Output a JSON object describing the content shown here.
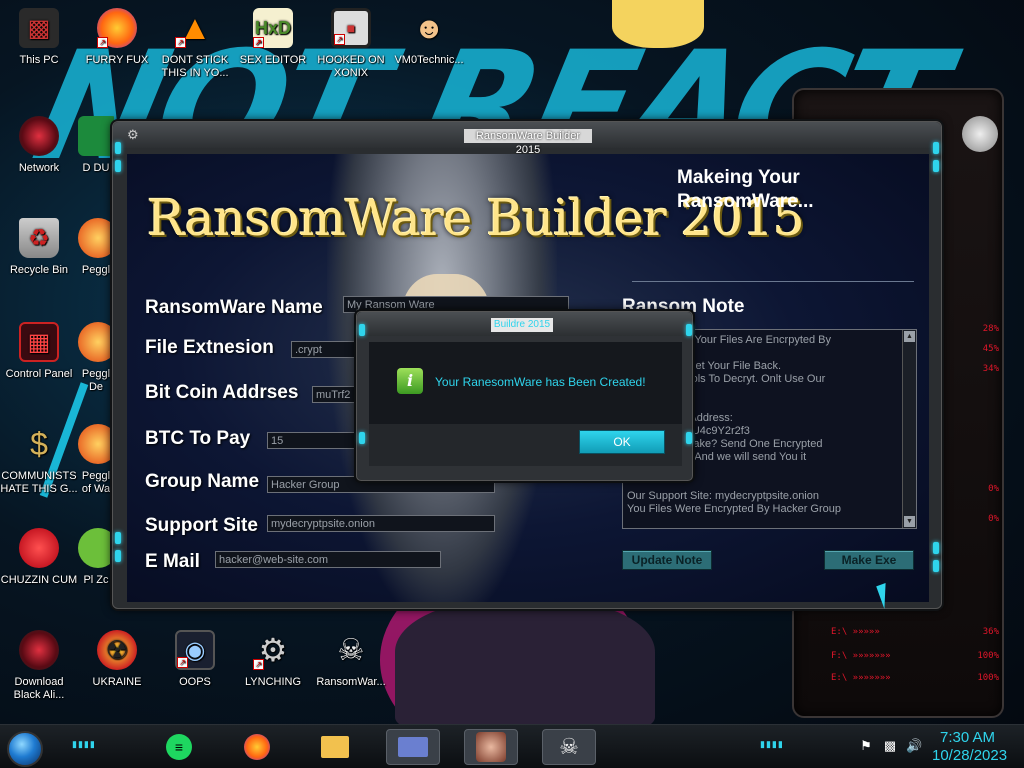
{
  "desktop": {
    "icons": [
      {
        "label": "This PC",
        "icon": "computer-icon"
      },
      {
        "label": "FURRY FUX",
        "icon": "firefox-icon"
      },
      {
        "label": "DONT STICK THIS IN YO...",
        "icon": "vlc-icon"
      },
      {
        "label": "SEX EDITOR",
        "icon": "hxd-icon"
      },
      {
        "label": "HOOKED ON XONIX",
        "icon": "xonix-icon"
      },
      {
        "label": "VM0Technic...",
        "icon": "doctor-icon"
      },
      {
        "label": "Network",
        "icon": "network-icon"
      },
      {
        "label": "Recycle Bin",
        "icon": "recycle-bin-icon"
      },
      {
        "label": "Control Panel",
        "icon": "control-panel-icon"
      },
      {
        "label": "COMMUNISTS HATE THIS G...",
        "icon": "money-bag-icon"
      },
      {
        "label": "CHUZZIN CUM",
        "icon": "chuzzle-icon"
      },
      {
        "label": "Download Black Ali...",
        "icon": "alien-orb-icon"
      },
      {
        "label": "UKRAINE",
        "icon": "radiation-icon"
      },
      {
        "label": "OOPS",
        "icon": "oops-icon"
      },
      {
        "label": "LYNCHING",
        "icon": "gear-icon"
      },
      {
        "label": "RansomWar...",
        "icon": "skull-icon"
      },
      {
        "label": "D DU",
        "icon": "generic-app-icon"
      },
      {
        "label": "Peggl",
        "icon": "peggle-icon"
      },
      {
        "label": "Peggl De",
        "icon": "peggle-icon"
      },
      {
        "label": "Peggl of Wa",
        "icon": "peggle-icon"
      },
      {
        "label": "Pl Zc",
        "icon": "plants-icon"
      }
    ]
  },
  "window": {
    "title": "RansomWare Builder 2015",
    "app_title": "RansomWare Builder 2015",
    "status": "Makeing Your RansomWare...",
    "fields": {
      "name_label": "RansomWare Name",
      "name_value": "My Ransom Ware",
      "ext_label": "File Extnesion",
      "ext_value": ".crypt",
      "btc_addr_label": "Bit Coin Addrses",
      "btc_addr_value": "muTrf2",
      "btc_pay_label": "BTC To Pay",
      "btc_pay_value": "15",
      "group_label": "Group Name",
      "group_value": "Hacker Group",
      "support_label": "Support Site",
      "support_value": "mydecryptpsite.onion",
      "email_label": "E Mail",
      "email_value": "hacker@web-site.com"
    },
    "note": {
      "title": "Ransom Note",
      "lines": [
        "So Sorry. But Your Files Are Encrpyted By",
        "are",
        "ry! You Can Get Your File Back.",
        "Use Other Tools To Decryt. Onlt Use Our",
        "",
        "",
        "Our Bit Coin Address:",
        "opS9TY4fEioU4c9Y2r2f3",
        "ous We Are Fake? Send One Encrypted",
        "web-site.com And we will send You it",
        "",
        "",
        "Our Support Site: mydecryptpsite.onion",
        "You Files Were Encrypted By Hacker Group"
      ]
    },
    "buttons": {
      "update": "Update Note",
      "make": "Make Exe"
    }
  },
  "dialog": {
    "title": "Buildre 2015",
    "message": "Your RanesomWare has Been Created!",
    "ok": "OK"
  },
  "taskbar": {
    "apps": [
      "spotify-icon",
      "firefox-icon",
      "file-explorer-icon",
      "id-card-icon",
      "photo-icon",
      "skull-icon"
    ],
    "time": "7:30 AM",
    "date": "10/28/2023"
  },
  "widget": {
    "percents": [
      "28%",
      "45%",
      "34%",
      "0%",
      "0%",
      "36%",
      "100%",
      "100%"
    ]
  },
  "colors": {
    "accent": "#2fd4ec",
    "title_gold": "#ffe58a",
    "alien_red": "#e0162a"
  }
}
